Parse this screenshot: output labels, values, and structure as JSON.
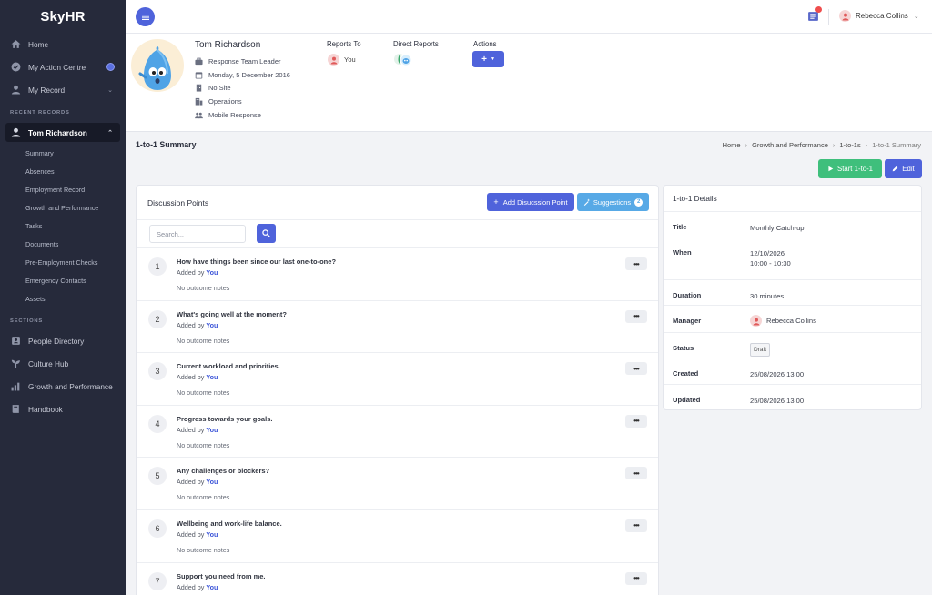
{
  "app": {
    "logo": "SkyHR"
  },
  "sidebar": {
    "nav": [
      {
        "label": "Home",
        "icon": "home-icon"
      },
      {
        "label": "My Action Centre",
        "icon": "check-circle-icon"
      },
      {
        "label": "My Record",
        "icon": "user-icon"
      }
    ],
    "recent_label": "RECENT RECORDS",
    "record": {
      "name": "Tom Richardson",
      "items": [
        "Summary",
        "Absences",
        "Employment Record",
        "Growth and Performance",
        "Tasks",
        "Documents",
        "Pre-Employment Checks",
        "Emergency Contacts",
        "Assets"
      ]
    },
    "sections_label": "SECTIONS",
    "sections": [
      {
        "label": "People Directory",
        "icon": "directory-icon"
      },
      {
        "label": "Culture Hub",
        "icon": "plant-icon"
      },
      {
        "label": "Growth and Performance",
        "icon": "growth-icon"
      },
      {
        "label": "Handbook",
        "icon": "book-icon"
      }
    ]
  },
  "topbar": {
    "user_name": "Rebecca Collins"
  },
  "profile": {
    "name": "Tom Richardson",
    "meta": [
      "Response Team Leader",
      "Monday, 5 December 2016",
      "No Site",
      "Operations",
      "Mobile Response"
    ],
    "reports_to_label": "Reports To",
    "reports_to_value": "You",
    "direct_reports_label": "Direct Reports",
    "actions_label": "Actions",
    "actions_button": "+"
  },
  "page": {
    "title": "1-to-1 Summary",
    "breadcrumb": [
      "Home",
      "Growth and Performance",
      "1-to-1s",
      "1-to-1 Summary"
    ],
    "start_button": "Start 1-to-1",
    "edit_button": "Edit"
  },
  "discussion": {
    "title": "Discussion Points",
    "add_button": "Add Disucssion Point",
    "suggestions_button": "Suggestions",
    "suggestions_count": "2",
    "search_placeholder": "Search...",
    "added_by_prefix": "Added by",
    "added_by_user": "You",
    "notes_text": "No outcome notes",
    "more_label": "•••",
    "items": [
      {
        "num": "1",
        "question": "How have things been since our last one-to-one?"
      },
      {
        "num": "2",
        "question": "What's going well at the moment?"
      },
      {
        "num": "3",
        "question": "Current workload and priorities."
      },
      {
        "num": "4",
        "question": "Progress towards your goals."
      },
      {
        "num": "5",
        "question": "Any challenges or blockers?"
      },
      {
        "num": "6",
        "question": "Wellbeing and work-life balance."
      },
      {
        "num": "7",
        "question": "Support you need from me."
      }
    ]
  },
  "details": {
    "title": "1-to-1 Details",
    "rows": {
      "title": {
        "label": "Title",
        "value": "Monthly Catch-up"
      },
      "when": {
        "label": "When",
        "date": "12/10/2026",
        "time": "10:00 - 10:30"
      },
      "duration": {
        "label": "Duration",
        "value": "30 minutes"
      },
      "manager": {
        "label": "Manager",
        "value": "Rebecca Collins"
      },
      "status": {
        "label": "Status",
        "value": "Draft"
      },
      "created": {
        "label": "Created",
        "value": "25/08/2026 13:00"
      },
      "updated": {
        "label": "Updated",
        "value": "25/08/2026 13:00"
      }
    }
  },
  "colors": {
    "primary": "#4f63db",
    "success": "#3fbf7c",
    "info": "#57a9e6",
    "sidebar": "#262a3b"
  }
}
